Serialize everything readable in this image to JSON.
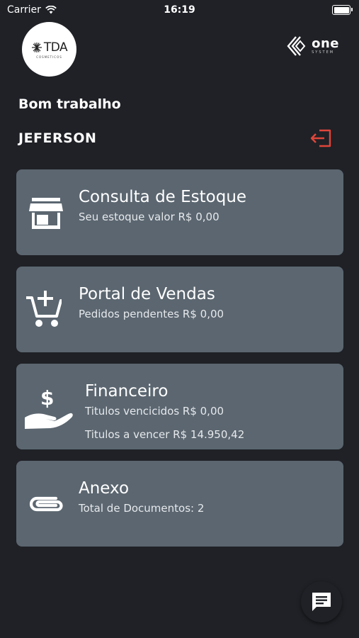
{
  "status_bar": {
    "carrier": "Carrier",
    "time": "16:19"
  },
  "logo": {
    "mark": "TDA",
    "sub": "COSMETICOS"
  },
  "brand": {
    "name": "ONE",
    "tag": "SYSTEM"
  },
  "greeting": "Bom trabalho",
  "user": {
    "name": "JEFERSON"
  },
  "colors": {
    "background": "#1f2126",
    "card": "#5b6670",
    "logout": "#e0453a"
  },
  "cards": [
    {
      "title": "Consulta de Estoque",
      "lines": [
        "Seu estoque valor R$ 0,00"
      ],
      "icon": "store-icon"
    },
    {
      "title": "Portal de Vendas",
      "lines": [
        "Pedidos  pendentes R$ 0,00"
      ],
      "icon": "cart-add-icon"
    },
    {
      "title": "Financeiro",
      "lines": [
        "Titulos vencicidos R$ 0,00",
        "Titulos a vencer R$ 14.950,42"
      ],
      "icon": "hand-dollar-icon"
    },
    {
      "title": "Anexo",
      "lines": [
        "Total de Documentos: 2"
      ],
      "icon": "paperclip-icon"
    }
  ],
  "icons": {
    "logout": "logout-icon",
    "chat": "chat-icon"
  }
}
